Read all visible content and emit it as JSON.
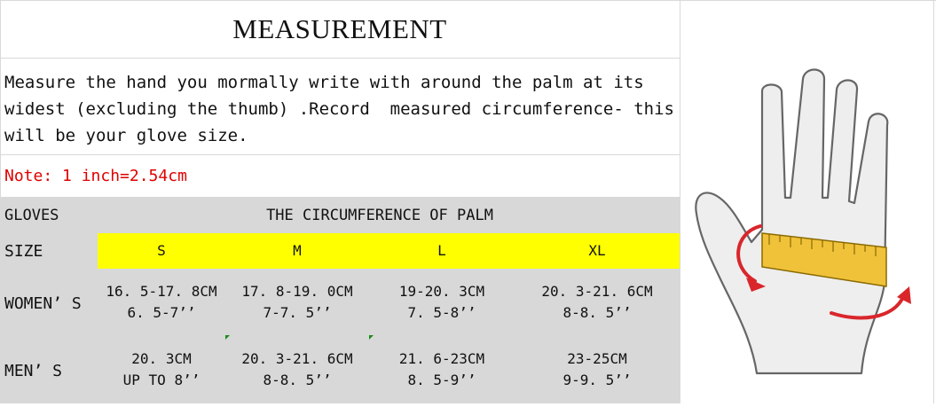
{
  "title": "MEASUREMENT",
  "instruction": "Measure the hand you mormally write with around the palm at its widest (excluding the thumb) .Record  measured circumference- this will be your glove size.",
  "note": "Note: 1 inch=2.54cm",
  "table": {
    "corner_label": "GLOVES",
    "group_header": "THE CIRCUMFERENCE OF PALM",
    "size_label": "SIZE",
    "sizes": [
      "S",
      "M",
      "L",
      "XL"
    ],
    "rows": [
      {
        "label": "WOMEN’ S",
        "cells": [
          {
            "cm": "16. 5-17. 8CM",
            "inch": "6. 5-7’’"
          },
          {
            "cm": "17. 8-19. 0CM",
            "inch": "7-7. 5’’"
          },
          {
            "cm": "19-20. 3CM",
            "inch": "7. 5-8’’"
          },
          {
            "cm": "20. 3-21. 6CM",
            "inch": "8-8. 5’’"
          }
        ]
      },
      {
        "label": "MEN’ S",
        "cells": [
          {
            "cm": "20. 3CM",
            "inch": "UP TO 8’’"
          },
          {
            "cm": "20. 3-21. 6CM",
            "inch": "8-8. 5’’"
          },
          {
            "cm": "21. 6-23CM",
            "inch": "8. 5-9’’"
          },
          {
            "cm": "23-25CM",
            "inch": "9-9. 5’’"
          }
        ]
      }
    ]
  },
  "colors": {
    "note": "#e00000",
    "highlight": "#ffff00",
    "header_bg": "#d8d8d8",
    "arrow": "#d9262b",
    "tape": "#f0c23a"
  },
  "illustration": {
    "icon": "hand-measuring-tape-illustration"
  }
}
